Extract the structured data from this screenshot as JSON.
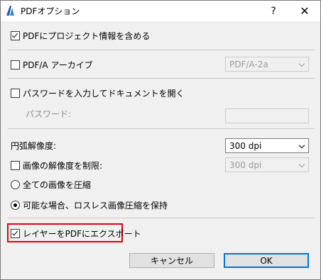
{
  "window": {
    "title": "PDFオプション",
    "help_label": "?",
    "close_label": "✕"
  },
  "options": {
    "include_project_info": {
      "label": "PDFにプロジェクト情報を含める",
      "checked": true
    },
    "pdfa_archive": {
      "label": "PDF/A アーカイブ",
      "checked": false,
      "dropdown_value": "PDF/A-2a"
    },
    "password_open": {
      "label": "パスワードを入力してドキュメントを開く",
      "checked": false
    },
    "password_field": {
      "label": "パスワード:",
      "value": ""
    },
    "arc_resolution": {
      "label": "円弧解像度:",
      "dropdown_value": "300 dpi"
    },
    "limit_image_resolution": {
      "label": "画像の解像度を制限:",
      "checked": false,
      "dropdown_value": "300 dpi"
    },
    "compress_all": {
      "label": "全ての画像を圧縮",
      "selected": false
    },
    "lossless_compress": {
      "label": "可能な場合、ロスレス画像圧縮を保持",
      "selected": true
    },
    "export_layers": {
      "label": "レイヤーをPDFにエクスポート",
      "checked": true
    }
  },
  "buttons": {
    "cancel": "キャンセル",
    "ok": "OK"
  },
  "colors": {
    "highlight": "#e60012",
    "default_button_border": "#0078d7"
  }
}
